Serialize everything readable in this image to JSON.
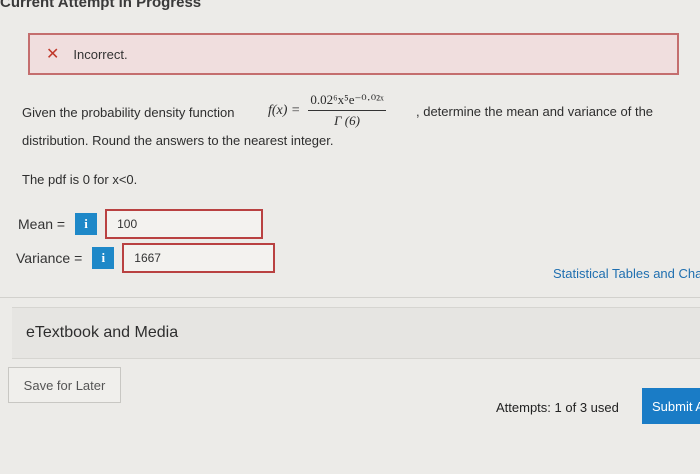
{
  "header": {
    "title": "Current Attempt in Progress"
  },
  "alert": {
    "icon": "close-icon",
    "text": "Incorrect.",
    "color": "#c0392b"
  },
  "question": {
    "intro": "Given the probability density function",
    "fx": "f(x) =",
    "numerator": "0.02⁶x⁵e⁻⁰·⁰²ˣ",
    "denominator": "Γ (6)",
    "tail": ", determine the mean and variance of the",
    "line2": "distribution. Round the answers to the nearest integer.",
    "pdf_note": "The pdf is 0 for x<0."
  },
  "answers": {
    "mean_label": "Mean =",
    "mean_value": "100",
    "variance_label": "Variance =",
    "variance_value": "1667",
    "info_glyph": "i"
  },
  "links": {
    "statistical_tables": "Statistical Tables and Cha"
  },
  "sections": {
    "etextbook": "eTextbook and Media"
  },
  "actions": {
    "save_label": "Save for Later",
    "attempts_text": "Attempts: 1 of 3 used",
    "submit_label": "Submit A"
  },
  "colors": {
    "accent": "#1a7cc6",
    "error": "#b94141"
  }
}
